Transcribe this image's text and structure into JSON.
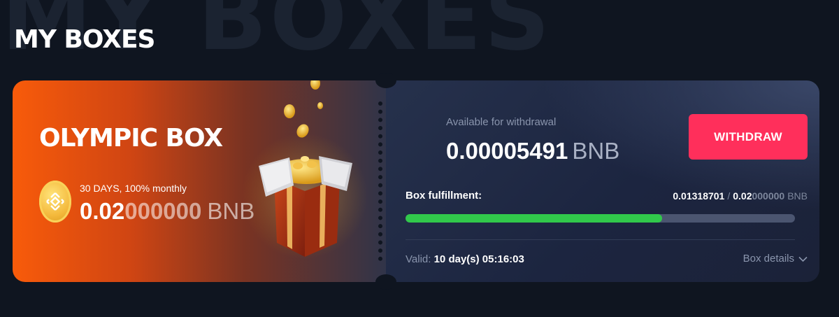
{
  "page": {
    "background_title": "MY BOXES",
    "title": "MY BOXES"
  },
  "box": {
    "name": "OLYMPIC BOX",
    "terms": "30 DAYS, 100% monthly",
    "amount_bold": "0.02",
    "amount_dim": "000000",
    "currency": "BNB",
    "coin_icon": "bnb-coin-icon",
    "illustration_icon": "treasure-box-icon"
  },
  "withdrawal": {
    "label": "Available for withdrawal",
    "amount": "0.00005491",
    "currency": "BNB",
    "button_label": "WITHDRAW"
  },
  "fulfillment": {
    "label": "Box fulfillment:",
    "current": "0.01318701",
    "separator": "/",
    "target_bold": "0.02",
    "target_dim": "000000",
    "currency": "BNB",
    "progress_percent": 65.9
  },
  "validity": {
    "label": "Valid:",
    "value": "10 day(s) 05:16:03"
  },
  "details": {
    "label": "Box details",
    "icon": "chevron-down-icon"
  },
  "colors": {
    "accent": "#ff2f5b",
    "progress": "#31c94b",
    "orange": "#f85b0a"
  }
}
